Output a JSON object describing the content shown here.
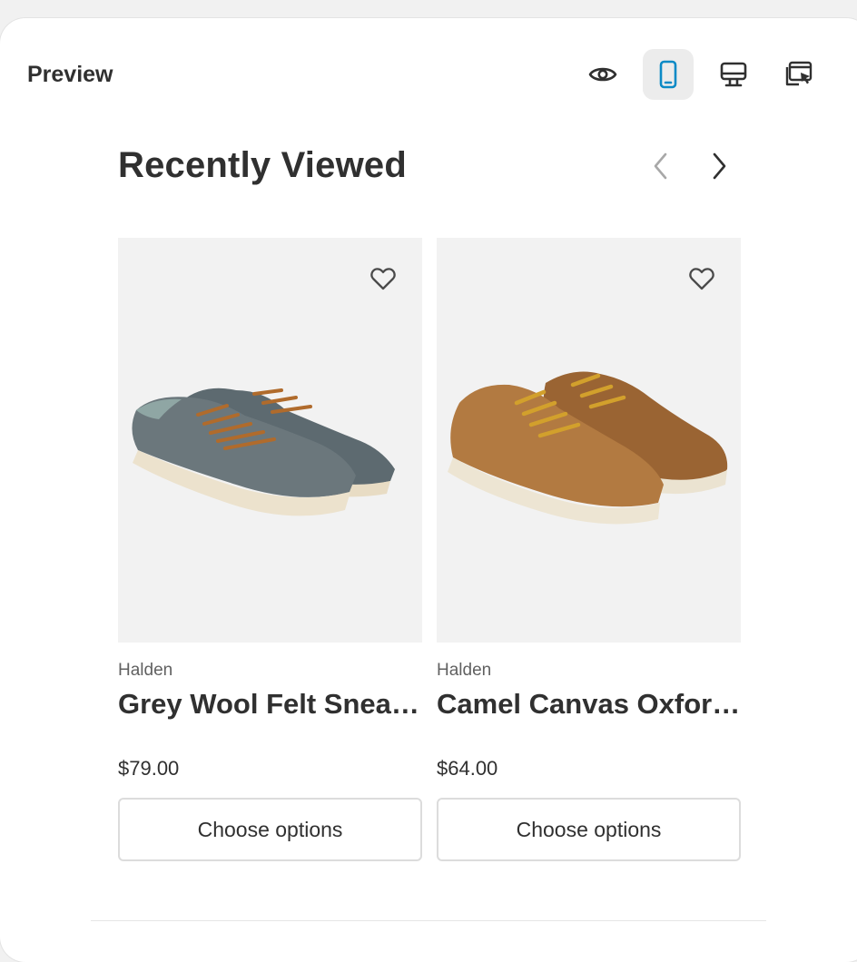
{
  "header": {
    "title": "Preview",
    "tools": [
      {
        "name": "eye-icon",
        "active": false
      },
      {
        "name": "mobile-icon",
        "active": true
      },
      {
        "name": "desktop-icon",
        "active": false
      },
      {
        "name": "inspector-icon",
        "active": false
      }
    ]
  },
  "section": {
    "title": "Recently Viewed"
  },
  "products": [
    {
      "vendor": "Halden",
      "title": "Grey Wool Felt Sneakers",
      "price": "$79.00",
      "button": "Choose options"
    },
    {
      "vendor": "Halden",
      "title": "Camel Canvas Oxfords",
      "price": "$64.00",
      "button": "Choose options"
    }
  ],
  "colors": {
    "accent": "#0b8ac6",
    "text": "#303030",
    "muted": "#616161",
    "card_bg": "#f2f2f2"
  }
}
